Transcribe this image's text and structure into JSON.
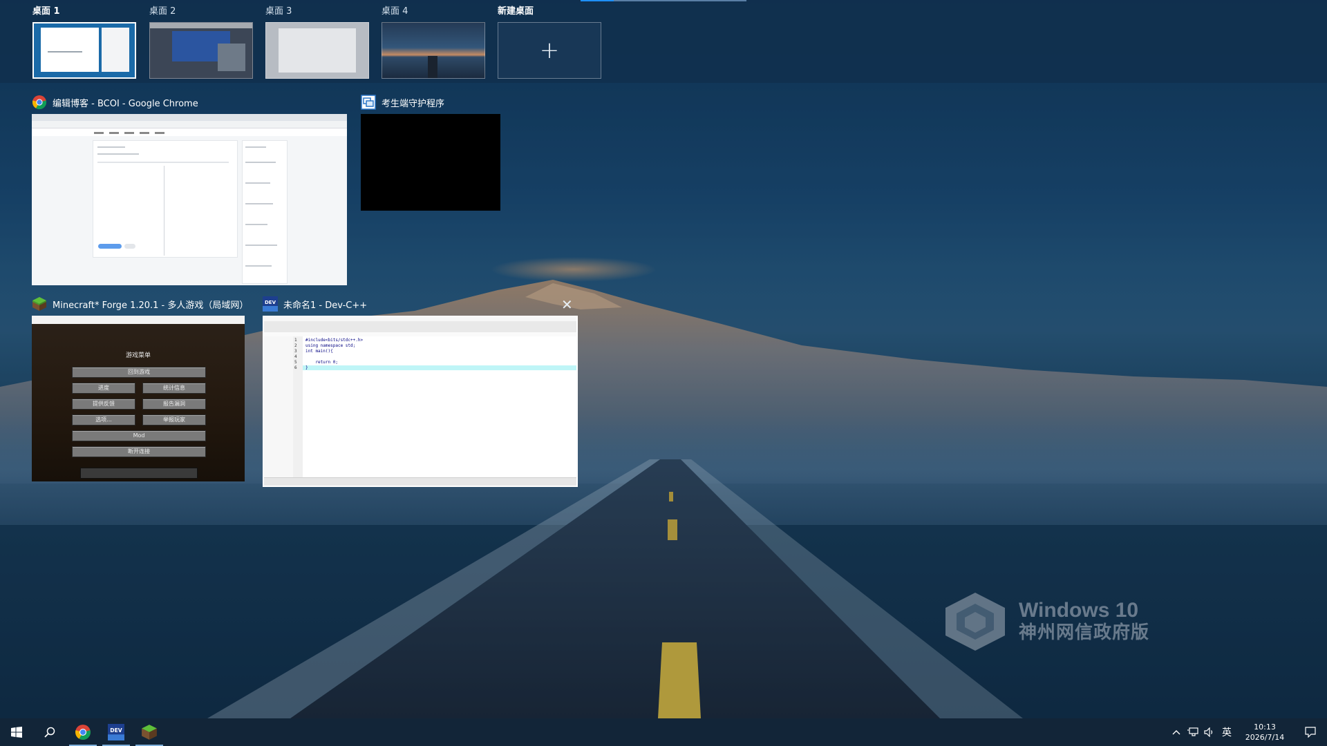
{
  "virtual_desktops": [
    {
      "label": "桌面 1",
      "active": true
    },
    {
      "label": "桌面 2",
      "active": false
    },
    {
      "label": "桌面 3",
      "active": false
    },
    {
      "label": "桌面 4",
      "active": false
    }
  ],
  "new_desktop_label": "新建桌面",
  "windows": {
    "chrome": {
      "title": "编辑博客 - BCOI - Google Chrome",
      "icon": "chrome-icon"
    },
    "guard": {
      "title": "考生端守护程序",
      "icon": "exam-guard-icon"
    },
    "minecraft": {
      "title": "Minecraft* Forge 1.20.1 - 多人游戏（局域网）",
      "icon": "minecraft-icon",
      "inner_title": "Minecraft* Forge 1.20.1 - 多人游戏（局域网）",
      "menu_title": "游戏菜单",
      "buttons": {
        "back": "回到游戏",
        "advancements": "进度",
        "statistics": "统计信息",
        "feedback": "提供反馈",
        "report_bugs": "报告漏洞",
        "options": "选项...",
        "player_reporting": "举报玩家",
        "mods": "Mod",
        "disconnect": "断开连接"
      }
    },
    "devcpp": {
      "title": "未命名1 - Dev-C++",
      "icon": "devcpp-icon",
      "code": [
        {
          "n": "1",
          "text": "#include<bits/stdc++.h>"
        },
        {
          "n": "2",
          "text": "using namespace std;"
        },
        {
          "n": "3",
          "text": "int main(){"
        },
        {
          "n": "4",
          "text": "    "
        },
        {
          "n": "5",
          "text": "    return 0;"
        },
        {
          "n": "6",
          "text": "}"
        }
      ]
    }
  },
  "watermark": {
    "title": "Windows 10",
    "subtitle": "神州网信政府版"
  },
  "taskbar": {
    "apps": [
      "start-icon",
      "search-icon",
      "chrome-icon",
      "devcpp-icon",
      "minecraft-icon"
    ],
    "tray": {
      "ime": "英",
      "time": "10:13",
      "date": "2026/7/14"
    }
  },
  "colors": {
    "taskbar": "#122538",
    "strip": "#10304e",
    "accent": "#1e90ff"
  }
}
